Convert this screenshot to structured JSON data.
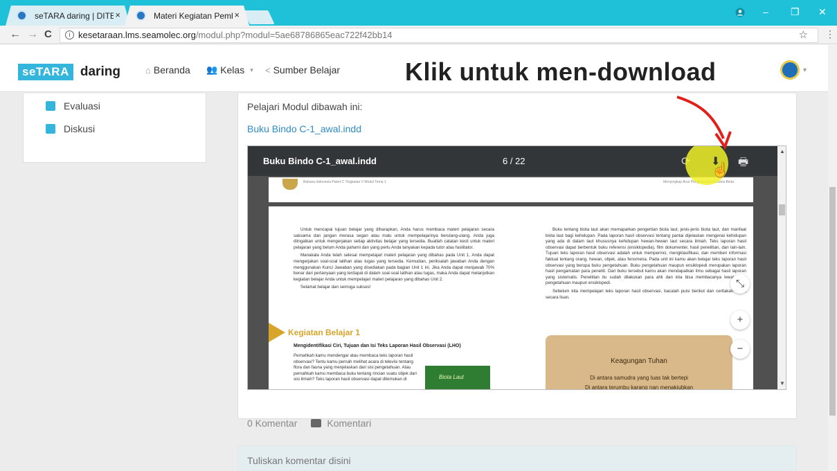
{
  "browser": {
    "tabs": [
      {
        "label": "seTARA daring | DITBIND",
        "close": "×"
      },
      {
        "label": "Materi Kegiatan Pembela",
        "close": "×"
      }
    ],
    "window": {
      "minimize": "–",
      "restore": "❐",
      "close": "✕"
    },
    "url_host": "kesetaraan.lms.seamolec.org",
    "url_path": "/modul.php?modul=5ae68786865eac722f42bb14",
    "nav": {
      "back": "←",
      "forward": "→",
      "reload": "C"
    },
    "star": "☆",
    "menu": "⋮"
  },
  "site": {
    "logo_box": "seTARA",
    "logo_text": "daring",
    "nav": [
      {
        "label": "Beranda",
        "icon": "home-icon"
      },
      {
        "label": "Kelas",
        "icon": "users-icon",
        "caret": "▾"
      },
      {
        "label": "Sumber Belajar",
        "icon": "share-icon"
      }
    ],
    "overlay_title": "Klik untuk men-download",
    "profile_caret": "▾"
  },
  "sidebar": {
    "items": [
      {
        "label": "Evaluasi",
        "icon": "clipboard-icon"
      },
      {
        "label": "Diskusi",
        "icon": "chat-icon"
      }
    ]
  },
  "main": {
    "instruction": "Pelajari Modul dibawah ini:",
    "doc_link": "Buku Bindo C-1_awal.indd"
  },
  "viewer": {
    "title": "Buku Bindo C-1_awal.indd",
    "page_indicator": "6 / 22",
    "icons": {
      "rotate": "⟳",
      "download": "⬇",
      "print": "🖶"
    },
    "zoom": {
      "fit": "⤡",
      "in": "+",
      "out": "−"
    },
    "scroll": {
      "up": "▲",
      "down": "▼"
    },
    "page": {
      "header_left": "Bahasa Indonesia Paket C Tingkatan V Modul Tema 1",
      "header_right": "Menyingkap Arus Pengetahuan di Dunia Biota",
      "left_paragraphs": [
        "Untuk mencapai tujuan belajar yang diharapkan, Anda harus membaca materi pelajaran secara saksama dan jangan merasa segan atau malu untuk mempelajarinya berulang-ulang. Anda juga diingatkan untuk mengerjakan setiap aktivitas belajar yang tersedia. Buatlah catatan kecil untuk materi pelajaran yang belum Anda pahami dan yang perlu Anda tanyakan kepada tutor atau fasilitator.",
        "Manakala Anda telah selesai mempelajari materi pelajaran yang dibahas pada Unit 1, Anda dapat mengerjakan soal-soal latihan atau tugas yang tersedia. Kemudian, periksalah jawaban Anda dengan menggunakan Kunci Jawaban yang disediakan pada bagian Unit 1 ini. Jika Anda dapat menjawab 70% benar dari pertanyaan yang terdapat di dalam soal-soal latihan atau tugas, maka Anda dapat melanjutkan kegiatan belajar Anda untuk mempelajari materi pelajaran yang dibahas Unit 2.",
        "Selamat belajar dan semoga sukses!"
      ],
      "kegiatan": "Kegiatan Belajar 1",
      "lho_title": "Mengidentifikasi Ciri, Tujuan dan Isi Teks Laporan Hasil Observasi (LHO)",
      "lho_text": "Pernahkah kamu mendengar atau membaca teks laporan hasil observasi? Tentu kamu pernah melihat acara di televisi tentang flora dan fauna yang menjelaskan dari sisi pengetahuan. Atau pernahkah kamu membaca buku tentang rincian suatu objek dari sisi ilmiah? Teks laporan hasil observasi dapat ditemukan di",
      "book_cover": "Biota Laut",
      "right_paragraphs": [
        "Buku tentang biota laut akan memaparkan pengertian biota laut, jenis-jenis biota laut, dan manfaat biota laut bagi kehidupan. Pada laporan hasil observasi tentang pantai dijelaskan mengenai kehidupan yang ada di dalam laut khususnya kehidupan hewan-hewan laut secara ilmiah. Teks laporan hasil observasi dapat berbentuk buku referensi (ensiklopedia), film dokumenter, hasil penelitian, dan lain-lain. Tujuan teks laporan hasil observasi adalah untuk memperinci, mengklasifikasi, dan memberi informasi faktual tentang orang, hewan, objek, atau fenomena. Pada unit ini kamu akan belajar teks laporan hasil observasi yang berupa buku pengetahuan. Buku pengetahuan maupun ensiklopedi merupakan laporan hasil pengamatan para peneliti. Dari buku tersebut kamu akan mendapatkan ilmu sebagai hasil laporan yang sistematis. Penelitian itu sudah dilakukan para ahli dan kita bisa membacanya lewat buku pengetahuan maupun ensiklopedi.",
        "Sebelum kita mempelajari teks laporan hasil observasi, bacalah puisi berikut dan ceritakan isinya secara lisan."
      ],
      "poem_title": "Keagungan Tuhan",
      "poem_line1": "Di antara samudra yang luas tak bertepi",
      "poem_line2": "Di antara terumbu karang nan menakjubkan"
    }
  },
  "comments": {
    "count": "0 Komentar",
    "button": "Komentari",
    "placeholder": "Tuliskan komentar disini"
  }
}
